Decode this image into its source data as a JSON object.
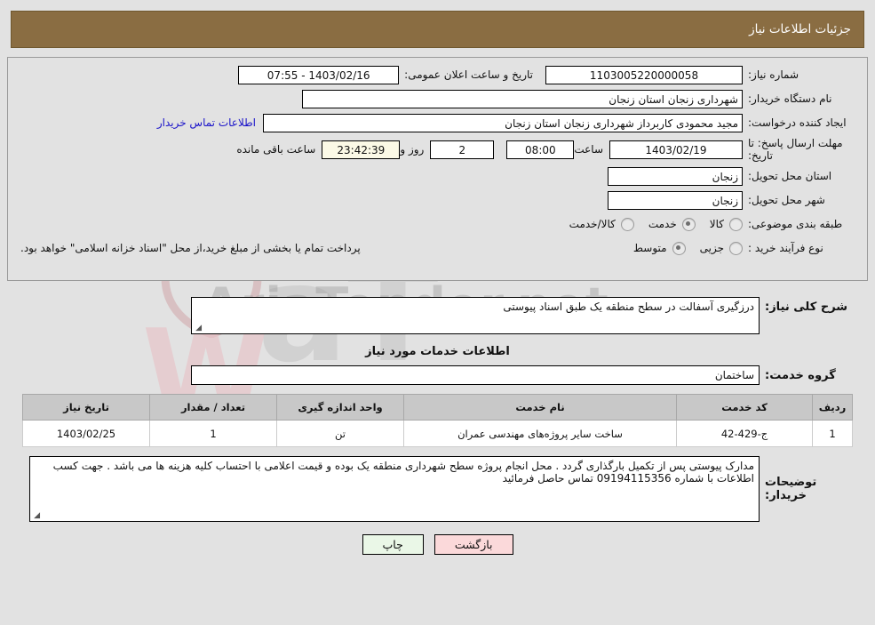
{
  "header": {
    "title": "جزئیات اطلاعات نیاز"
  },
  "fields": {
    "need_number_label": "شماره نیاز:",
    "need_number_value": "1103005220000058",
    "announce_label": "تاریخ و ساعت اعلان عمومی:",
    "announce_value": "1403/02/16 - 07:55",
    "buyer_org_label": "نام دستگاه خریدار:",
    "buyer_org_value": "شهرداری زنجان استان زنجان",
    "creator_label": "ایجاد کننده درخواست:",
    "creator_value": "مجید محمودی کاربرداز شهرداری زنجان استان زنجان",
    "contact_link": "اطلاعات تماس خریدار",
    "deadline_label": "مهلت ارسال پاسخ: تا تاریخ:",
    "deadline_date": "1403/02/19",
    "hour_label": "ساعت",
    "deadline_time": "08:00",
    "days_value": "2",
    "days_label": "روز و",
    "countdown_value": "23:42:39",
    "remaining_label": "ساعت باقی مانده",
    "province_label": "استان محل تحویل:",
    "province_value": "زنجان",
    "city_label": "شهر محل تحویل:",
    "city_value": "زنجان",
    "category_label": "طبقه بندی موضوعی:",
    "process_label": "نوع فرآیند خرید :",
    "pay_note": "پرداخت تمام یا بخشی از مبلغ خرید،از محل \"اسناد خزانه اسلامی\" خواهد بود."
  },
  "category_options": [
    {
      "label": "کالا",
      "checked": false
    },
    {
      "label": "خدمت",
      "checked": true
    },
    {
      "label": "کالا/خدمت",
      "checked": false
    }
  ],
  "process_options": [
    {
      "label": "جزیی",
      "checked": false
    },
    {
      "label": "متوسط",
      "checked": true
    }
  ],
  "description": {
    "label": "شرح کلی نیاز:",
    "value": "درزگیری آسفالت در سطح منطقه یک طبق اسناد پیوستی"
  },
  "services_section": {
    "heading": "اطلاعات خدمات مورد نیاز",
    "group_label": "گروه خدمت:",
    "group_value": "ساختمان"
  },
  "table": {
    "columns": [
      "ردیف",
      "کد خدمت",
      "نام خدمت",
      "واحد اندازه گیری",
      "تعداد / مقدار",
      "تاریخ نیاز"
    ],
    "rows": [
      {
        "index": "1",
        "code": "ج-429-42",
        "name": "ساخت سایر پروژه‌های مهندسی عمران",
        "unit": "تن",
        "quantity": "1",
        "need_date": "1403/02/25"
      }
    ]
  },
  "buyer_notes": {
    "label": "توضیحات خریدار:",
    "value": "مدارک پیوستی پس از تکمیل  بارگذاری گردد . محل انجام پروژه سطح شهرداری منطقه یک بوده و قیمت اعلامی با احتساب کلیه هزینه ها می باشد . جهت کسب اطلاعات با شماره 09194115356 تماس حاصل فرمائید"
  },
  "footer": {
    "print_label": "چاپ",
    "back_label": "بازگشت"
  },
  "watermark": {
    "text": "AriaTender.net"
  }
}
